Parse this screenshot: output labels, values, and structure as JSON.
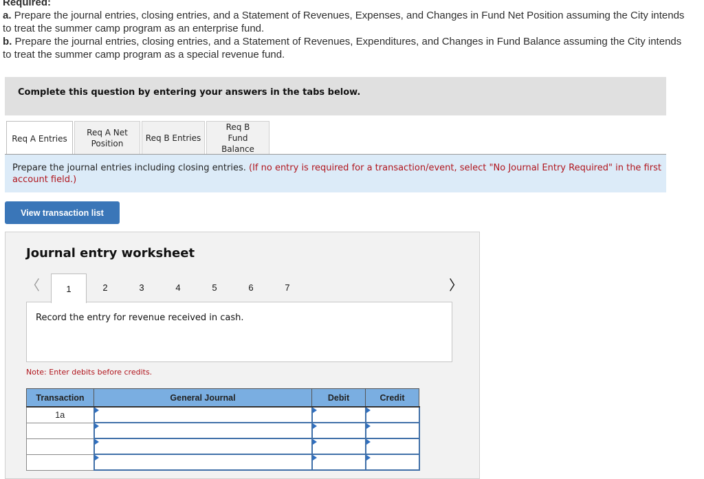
{
  "required": {
    "heading": "Required:",
    "a_label": "a.",
    "a_text": " Prepare the journal entries, closing entries, and a Statement of Revenues, Expenses, and Changes in Fund Net Position assuming the City intends to treat the summer camp program as an enterprise fund.",
    "b_label": "b.",
    "b_text": " Prepare the journal entries, closing entries, and a Statement of Revenues, Expenditures, and Changes in Fund Balance assuming the City intends to treat the summer camp program as a special revenue fund."
  },
  "complete_banner": "Complete this question by entering your answers in the tabs below.",
  "tabs": [
    {
      "label": "Req A Entries",
      "active": true
    },
    {
      "label": "Req A Net Position",
      "active": false
    },
    {
      "label": "Req B Entries",
      "active": false
    },
    {
      "label": "Req B Fund Balance",
      "active": false
    }
  ],
  "instructions": {
    "main": "Prepare the journal entries including closing entries. ",
    "note": "(If no entry is required for a transaction/event, select \"No Journal Entry Required\" in the first account field.)"
  },
  "view_button": "View transaction list",
  "worksheet": {
    "title": "Journal entry worksheet",
    "prev_icon": "chevron-left-icon",
    "next_icon": "chevron-right-icon",
    "steps": [
      "1",
      "2",
      "3",
      "4",
      "5",
      "6",
      "7"
    ],
    "active_step": "1",
    "entry_description": "Record the entry for revenue received in cash.",
    "note": "Note: Enter debits before credits."
  },
  "journal_table": {
    "headers": [
      "Transaction",
      "General Journal",
      "Debit",
      "Credit"
    ],
    "rows": [
      {
        "transaction": "1a",
        "account": "",
        "debit": "",
        "credit": ""
      },
      {
        "transaction": "",
        "account": "",
        "debit": "",
        "credit": ""
      },
      {
        "transaction": "",
        "account": "",
        "debit": "",
        "credit": ""
      },
      {
        "transaction": "",
        "account": "",
        "debit": "",
        "credit": ""
      }
    ]
  }
}
